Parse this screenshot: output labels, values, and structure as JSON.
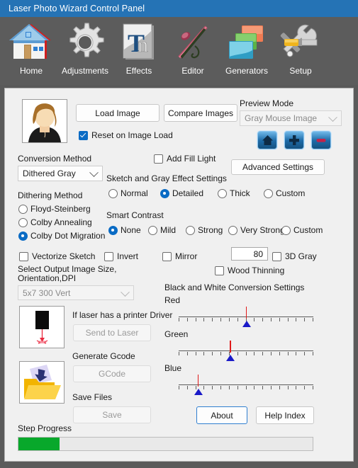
{
  "window": {
    "title": "Laser Photo Wizard Control Panel"
  },
  "toolbar": {
    "items": [
      {
        "label": "Home",
        "icon": "house-icon"
      },
      {
        "label": "Adjustments",
        "icon": "gear-icon"
      },
      {
        "label": "Effects",
        "icon": "text-effects-icon"
      },
      {
        "label": "Editor",
        "icon": "pen-brush-icon"
      },
      {
        "label": "Generators",
        "icon": "stacked-cards-icon"
      },
      {
        "label": "Setup",
        "icon": "wrench-screwdriver-icon"
      }
    ]
  },
  "main": {
    "load_image_label": "Load Image",
    "compare_images_label": "Compare Images",
    "reset_on_image_load_label": "Reset on Image Load",
    "reset_on_image_load_checked": true,
    "preview_mode_label": "Preview Mode",
    "preview_mode_value": "Gray Mouse Image",
    "preview_buttons": [
      {
        "name": "home-button",
        "icon": "home-icon"
      },
      {
        "name": "zoom-in-button",
        "icon": "plus-icon"
      },
      {
        "name": "zoom-out-button",
        "icon": "minus-icon"
      }
    ],
    "advanced_settings_label": "Advanced Settings",
    "conversion_method_label": "Conversion Method",
    "conversion_method_value": "Dithered Gray",
    "add_fill_light_label": "Add Fill Light",
    "add_fill_light_checked": false,
    "sketch_gray_label": "Sketch and Gray Effect Settings",
    "sketch_gray_options": [
      "Normal",
      "Detailed",
      "Thick",
      "Custom"
    ],
    "sketch_gray_selected": "Detailed",
    "dithering_method_label": "Dithering Method",
    "dithering_options": [
      "Floyd-Steinberg",
      "Colby Annealing",
      "Colby Dot Migration"
    ],
    "dithering_selected": "Colby Dot Migration",
    "smart_contrast_label": "Smart Contrast",
    "smart_contrast_options": [
      "None",
      "Mild",
      "Strong",
      "Very Strong",
      "Custom"
    ],
    "smart_contrast_selected": "None",
    "vectorize_sketch_label": "Vectorize Sketch",
    "vectorize_sketch_checked": false,
    "invert_label": "Invert",
    "invert_checked": false,
    "mirror_label": "Mirror",
    "mirror_checked": false,
    "threshold_value": "80",
    "three_d_gray_label": "3D Gray",
    "three_d_gray_checked": false,
    "wood_thinning_label": "Wood Thinning",
    "wood_thinning_checked": false,
    "output_size_label": "Select Output Image Size,\nOrientation,DPI",
    "output_size_value": "5x7 300 Vert",
    "printer_driver_label": "If laser has a printer Driver",
    "send_to_laser_label": "Send to Laser",
    "generate_gcode_label": "Generate Gcode",
    "gcode_label": "GCode",
    "save_files_label": "Save Files",
    "save_label": "Save",
    "step_progress_label": "Step Progress",
    "step_progress_percent": 14,
    "bw_conversion_label": "Black and White Conversion Settings",
    "about_label": "About",
    "help_index_label": "Help Index"
  },
  "sliders": [
    {
      "label": "Red",
      "position_percent": 50,
      "ticks": 16
    },
    {
      "label": "Green",
      "position_percent": 38,
      "ticks": 16
    },
    {
      "label": "Blue",
      "position_percent": 14,
      "ticks": 16
    }
  ],
  "colors": {
    "title_bar": "#2573b5",
    "toolbar": "#5c5c5c",
    "client": "#f0f0f0",
    "accent": "#0a6bc4",
    "progress_green": "#08a82b",
    "slider_needle": "#e01b1b",
    "slider_thumb": "#1a1ac8"
  }
}
